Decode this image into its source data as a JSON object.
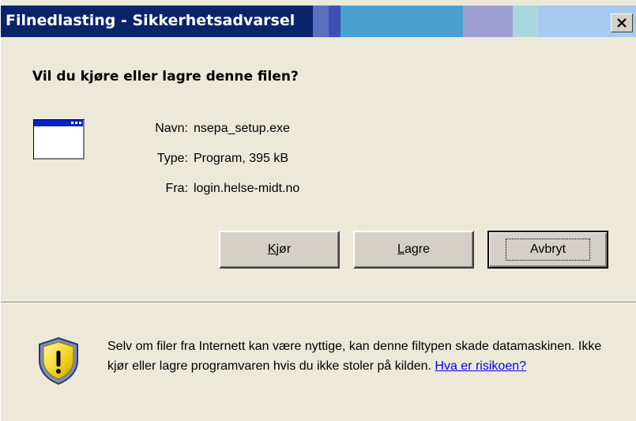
{
  "window": {
    "title": "Filnedlasting - Sikkerhetsadvarsel",
    "close_label": "×"
  },
  "dialog": {
    "question": "Vil du kjøre eller lagre denne filen?",
    "file_info": {
      "name_label": "Navn:",
      "name_value": "nsepa_setup.exe",
      "type_label": "Type:",
      "type_value": "Program, 395 kB",
      "from_label": "Fra:",
      "from_value": "login.helse-midt.no"
    },
    "buttons": {
      "run_label": "Kjør",
      "save_label": "Lagre",
      "cancel_label": "Avbryt"
    },
    "warning": {
      "text": "Selv om filer fra Internett kan være nyttige, kan denne filtypen skade datamaskinen. Ikke kjør eller lagre programvaren hvis du ikke stoler på kilden.",
      "link_label": "Hva er risikoen?"
    }
  },
  "icons": {
    "file_icon": "program-window-icon",
    "warning_icon": "security-shield-warning-icon",
    "close_icon": "close-icon"
  },
  "colors": {
    "titlebar_start": "#0a246a",
    "dialog_background": "#ece9d8",
    "link": "#0000ee"
  }
}
